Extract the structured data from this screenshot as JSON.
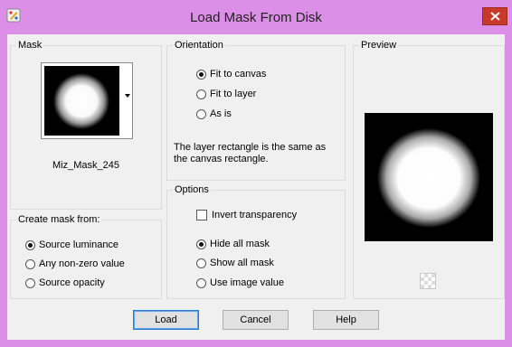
{
  "window": {
    "title": "Load Mask From Disk",
    "icon": "app-palette-icon",
    "close_icon": "close-icon"
  },
  "mask_group": {
    "legend": "Mask",
    "mask_name": "Miz_Mask_245"
  },
  "create_from": {
    "legend": "Create mask from:",
    "options": [
      "Source luminance",
      "Any non-zero value",
      "Source opacity"
    ],
    "selected": "Source luminance"
  },
  "orientation": {
    "legend": "Orientation",
    "options": [
      "Fit to canvas",
      "Fit to layer",
      "As is"
    ],
    "selected": "Fit to canvas",
    "info": "The layer rectangle is the same as the canvas rectangle."
  },
  "options": {
    "legend": "Options",
    "invert_label": "Invert transparency",
    "invert_checked": false,
    "mask_options": [
      "Hide all mask",
      "Show all mask",
      "Use image value"
    ],
    "selected": "Hide all mask"
  },
  "preview": {
    "legend": "Preview",
    "toggle_icon": "transparency-checker-icon"
  },
  "buttons": {
    "load": "Load",
    "cancel": "Cancel",
    "help": "Help"
  }
}
